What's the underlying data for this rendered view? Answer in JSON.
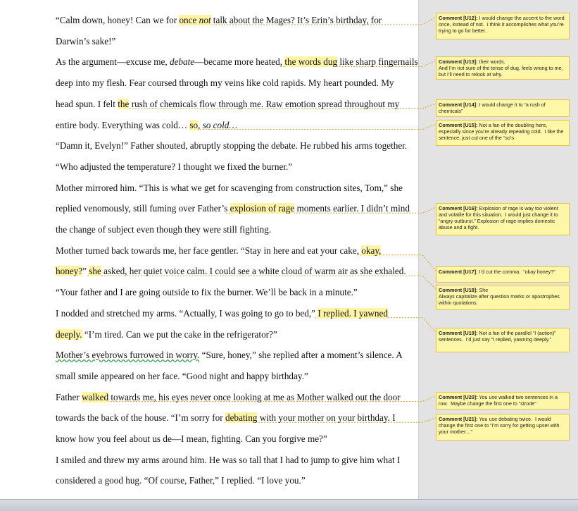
{
  "document": {
    "lines": [
      {
        "pre": "“Calm down, honey!  Can we for ",
        "hl": "once",
        "mid_em": " not",
        "post": " talk about the Mages?  It’s Erin’s birthday, for"
      },
      {
        "text": "Darwin’s sake!”"
      },
      {
        "pre": "As the argument—excuse me, ",
        "em": "debate",
        "mid": "—became more heated, ",
        "hl": "the words dug",
        "post": " like sharp fingernails"
      },
      {
        "text": "deep into my flesh.  Fear coursed through my veins like cold rapids.  My heart pounded.  My"
      },
      {
        "pre": "head spun.  I felt ",
        "hl": "the",
        "post": " rush of chemicals flow through me.  Raw emotion spread throughout my"
      },
      {
        "pre": "entire body.   Everything was cold… ",
        "hl": "so",
        "em": ", so cold…"
      },
      {
        "text": "“Damn it, Evelyn!” Father shouted, abruptly stopping the debate.  He rubbed his arms together."
      },
      {
        "text": "“Who adjusted the temperature?  I thought we fixed the burner.”"
      },
      {
        "text": "Mother mirrored him.  “This is what we get for scavenging from construction sites, Tom,” she"
      },
      {
        "pre": "replied venomously, still fuming over Father’s ",
        "hl": "explosion of rage",
        "post": " moments earlier.  I didn’t mind"
      },
      {
        "text": "the change of subject even though they were still fighting."
      },
      {
        "pre": "Mother turned back towards me, her face gentler.  “Stay in here and eat your cake, ",
        "hl": "okay,"
      },
      {
        "hl": "honey?",
        "mid": "” ",
        "hl2": "she",
        "post": " asked, her quiet voice calm.  I could see a white cloud of warm air as she exhaled."
      },
      {
        "text": "“Your father and I are going outside to fix the burner.  We’ll be back in a minute.”"
      },
      {
        "pre": "I nodded and stretched my arms.  “Actually, I was going to go to bed,” ",
        "hl": "I replied.  I yawned"
      },
      {
        "hl": "deeply.",
        "post": "  “I’m tired.  Can we put the cake in the refrigerator?”"
      },
      {
        "ul": "Mother’s eyebrows furrowed in worry.",
        "post": "  “Sure, honey,” she replied after a moment’s silence.  A"
      },
      {
        "text": "small smile appeared on her face.  “Good night and happy birthday.”"
      },
      {
        "pre": "Father ",
        "hl": "walked",
        "post": " towards me, his eyes never once looking at me as Mother walked out the door"
      },
      {
        "pre": "towards the back of the house.  “I’m sorry for ",
        "hl": "debating",
        "post": " with your mother on your birthday.  I"
      },
      {
        "text": "know how you feel about us de—I mean, fighting.  Can you forgive me?”"
      },
      {
        "text": "I smiled and threw my arms around him.  He was so tall that I had to jump to give him what I"
      },
      {
        "text": "considered a good hug.  “Of course, Father,” I replied.  “I love you.”"
      }
    ]
  },
  "comments": [
    {
      "label": "Comment [U12]:",
      "text": " I would change the accent to the word once, instead of not.  I think it accomplishes what you’re trying to go for better."
    },
    {
      "label": "Comment [U13]:",
      "text": " their words.\nAnd I’m not sure of the tense of dug, feels wrong to me, but I’ll need to relook at why."
    },
    {
      "label": "Comment [U14]:",
      "text": " I would change it to “a rush of chemicals”"
    },
    {
      "label": "Comment [U15]:",
      "text": " Not a fan of the doubling here, especially since you’re already repeating cold.  I like the sentence, just cut one of the “so’s"
    },
    {
      "label": "Comment [U16]:",
      "text": " Explosion of rage is way too violent and volatile for this situation.  I would just change it to “angry outburst.” Explosion of rage implies domestic abuse and a fight."
    },
    {
      "label": "Comment [U17]:",
      "text": " I’d cut the comma.  “okay honey?”"
    },
    {
      "label": "Comment [U18]:",
      "text": " She\nAlways capitalize after question marks or apostrophes within quotations."
    },
    {
      "label": "Comment [U19]:",
      "text": " Not a fan of the parallel “I (action)” sentences.  I’d just say “I replied, yawning deeply.”"
    },
    {
      "label": "Comment [U20]:",
      "text": " You use walked two sentences in a row.  Maybe change the first one to “strode”"
    },
    {
      "label": "Comment [U21]:",
      "text": " You use debating twice.  I would change the first one to “I’m sorry for getting upset with your mother…”"
    }
  ]
}
